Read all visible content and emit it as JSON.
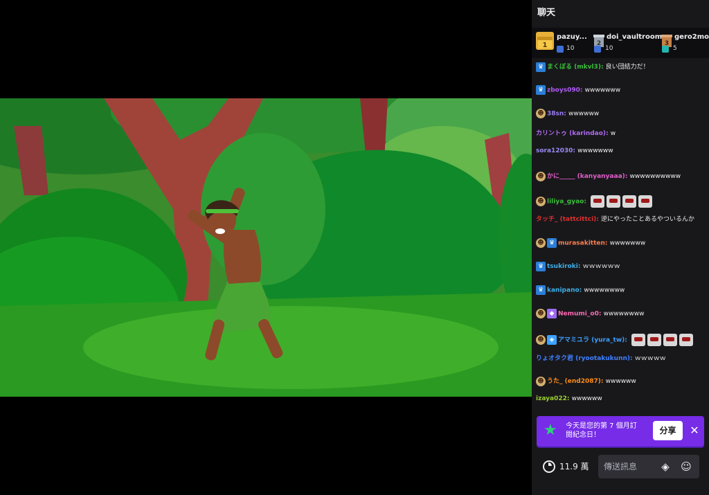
{
  "chat": {
    "title": "聊天",
    "leaderboard": [
      {
        "rank": "1",
        "name": "pazuy...",
        "count": "10",
        "rank_color": "#e8b23a",
        "gift_color": "#3d6fd6"
      },
      {
        "rank": "2",
        "name": "doi_vaultroom",
        "count": "10",
        "rank_color": "#9aa3ad",
        "gift_color": "#3d6fd6"
      },
      {
        "rank": "3",
        "name": "gero2mo",
        "count": "5",
        "rank_color": "#c7824a",
        "gift_color": "#25b5b0"
      }
    ],
    "messages": [
      {
        "badges": [
          "crown"
        ],
        "author": "まくぼる (mkvl3)",
        "color": "#3cbf3c",
        "text": "良い団結力だ！",
        "emotes": 0
      },
      {
        "badges": [
          "crown"
        ],
        "author": "zboys090",
        "color": "#b05bf5",
        "text": "wwwwwww",
        "emotes": 0
      },
      {
        "badges": [
          "sub"
        ],
        "author": "38sn",
        "color": "#9a7df0",
        "text": "wwwwww",
        "emotes": 0
      },
      {
        "badges": [],
        "author": "カリントゥ (karindao)",
        "color": "#b06bf0",
        "text": "w",
        "emotes": 0
      },
      {
        "badges": [],
        "author": "sora12030",
        "color": "#9a8af5",
        "text": "wwwwwww",
        "emotes": 0
      },
      {
        "badges": [
          "sub"
        ],
        "author": "かに_____ (kanyanyaaa)",
        "color": "#e05fc8",
        "text": "wwwwwwwwww",
        "emotes": 0
      },
      {
        "badges": [
          "sub"
        ],
        "author": "liliya_gyao",
        "color": "#3cbf3c",
        "text": "",
        "emotes": 4
      },
      {
        "badges": [],
        "author": "タッチ_ (tattcittci)",
        "color": "#e03030",
        "text": "逆にやったことあるやついるんか",
        "emotes": 0
      },
      {
        "badges": [
          "sub",
          "crown"
        ],
        "author": "murasakitten",
        "color": "#ff7f50",
        "text": "wwwwwww",
        "emotes": 0
      },
      {
        "badges": [
          "crown"
        ],
        "author": "tsukiroki",
        "color": "#3fb0e8",
        "text": "ｗｗｗｗｗｗ",
        "emotes": 0
      },
      {
        "badges": [
          "crown"
        ],
        "author": "kanipano",
        "color": "#3fb0e8",
        "text": "wwwwwwww",
        "emotes": 0
      },
      {
        "badges": [
          "sub",
          "gem"
        ],
        "author": "Nemumi_o0",
        "color": "#ff69b4",
        "text": "wwwwwwww",
        "emotes": 0
      },
      {
        "badges": [
          "sub",
          "diamond"
        ],
        "author": "アマミユラ (yura_tw)",
        "color": "#3fa0ff",
        "text": "",
        "emotes": 4
      },
      {
        "badges": [],
        "author": "りょオタク君 (ryootakukunn)",
        "color": "#3f80ff",
        "text": "ｗｗｗｗｗ",
        "emotes": 0
      },
      {
        "badges": [
          "sub"
        ],
        "author": "うた_ (end2087)",
        "color": "#ff8c1a",
        "text": "wwwwww",
        "emotes": 0
      },
      {
        "badges": [],
        "author": "izaya022",
        "color": "#9acd32",
        "text": "wwwwww",
        "emotes": 0
      }
    ],
    "banner": {
      "text": "今天是您的第 7 個月訂閱紀念日！",
      "share_label": "分享",
      "close_label": "✕",
      "star": "★"
    },
    "bottom": {
      "points": "11.9 萬",
      "input_placeholder": "傳送訊息",
      "bits_icon": "◈",
      "emote_icon": "☺"
    }
  }
}
